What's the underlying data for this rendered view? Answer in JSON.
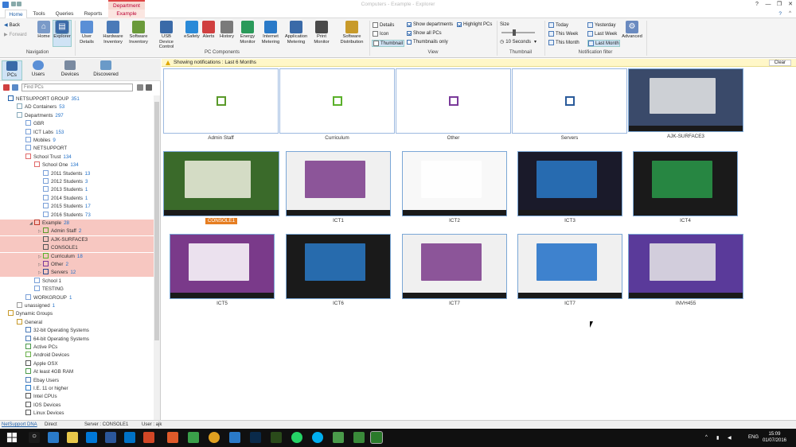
{
  "window": {
    "title": "Computers - Example - Explorer",
    "context_tab_group": "Department",
    "controls": [
      "?",
      "—",
      "❐",
      "✕"
    ]
  },
  "tabs": [
    {
      "label": "Home",
      "active": true
    },
    {
      "label": "Tools"
    },
    {
      "label": "Queries"
    },
    {
      "label": "Reports"
    },
    {
      "label": "Example",
      "contextual": true
    }
  ],
  "ribbon": {
    "navigation": {
      "back": "Back",
      "forward": "Forward",
      "home": "Home",
      "explorer": "Explorer",
      "group_label": "Navigation"
    },
    "pc_components": {
      "items": [
        {
          "label": "User Details",
          "icon": "user-details-icon",
          "color": "#5a8fd6"
        },
        {
          "label": "Hardware Inventory",
          "icon": "hardware-icon",
          "color": "#4a7ab8"
        },
        {
          "label": "Software Inventory",
          "icon": "software-icon",
          "color": "#6a9a3a"
        },
        {
          "label": "USB Device Control",
          "icon": "usb-icon",
          "color": "#3a6aa8"
        },
        {
          "label": "eSafety",
          "icon": "esafety-icon",
          "color": "#2a8ad8"
        },
        {
          "label": "Alerts",
          "icon": "alerts-icon",
          "color": "#d04040"
        },
        {
          "label": "History",
          "icon": "history-icon",
          "color": "#7a7a7a"
        },
        {
          "label": "Energy Monitor",
          "icon": "energy-icon",
          "color": "#2a9a5a"
        },
        {
          "label": "Internet Metering",
          "icon": "internet-icon",
          "color": "#2a7ac8"
        },
        {
          "label": "Application Metering",
          "icon": "application-icon",
          "color": "#3a6aa8"
        },
        {
          "label": "Print Monitor",
          "icon": "print-icon",
          "color": "#4a4a4a"
        },
        {
          "label": "Software Distribution",
          "icon": "distribution-icon",
          "color": "#c89a2a"
        }
      ],
      "group_label": "PC Components"
    },
    "view": {
      "modes": [
        "Details",
        "Icon",
        "Thumbnail"
      ],
      "selected_mode": "Thumbnail",
      "checks": [
        {
          "label": "Show departments",
          "checked": true
        },
        {
          "label": "Show all PCs",
          "checked": true
        },
        {
          "label": "Thumbnails only",
          "checked": false
        },
        {
          "label": "Highlight PCs",
          "checked": true
        }
      ],
      "group_label": "View"
    },
    "thumbnail": {
      "size_label": "Size",
      "interval": "10 Seconds",
      "group_label": "Thumbnail"
    },
    "notification_filter": {
      "items": [
        "Today",
        "This Week",
        "This Month",
        "Yesterday",
        "Last Week",
        "Last Month"
      ],
      "advanced": "Advanced",
      "group_label": "Notification filter"
    }
  },
  "left_nav": {
    "buttons": [
      "PCs",
      "Users",
      "Devices",
      "Discovered"
    ],
    "selected": "PCs",
    "search_placeholder": "Find PCs"
  },
  "tree": [
    {
      "label": "NETSUPPORT GROUP",
      "count": "351",
      "indent": 0,
      "color": "#1f5fa8"
    },
    {
      "label": "AD Containers",
      "count": "53",
      "indent": 1,
      "color": "#8ab"
    },
    {
      "label": "Departments",
      "count": "297",
      "indent": 1,
      "color": "#8ab"
    },
    {
      "label": "GBR",
      "count": "",
      "indent": 2,
      "color": "#7aa0d8"
    },
    {
      "label": "ICT Labs",
      "count": "153",
      "indent": 2,
      "color": "#7aa0d8"
    },
    {
      "label": "Mobiles",
      "count": "9",
      "indent": 2,
      "color": "#7aa0d8"
    },
    {
      "label": "NETSUPPORT",
      "count": "",
      "indent": 2,
      "color": "#7aa0d8"
    },
    {
      "label": "School Trust",
      "count": "134",
      "indent": 2,
      "color": "#e06a6a"
    },
    {
      "label": "School One",
      "count": "134",
      "indent": 3,
      "color": "#e06a6a"
    },
    {
      "label": "2011 Students",
      "count": "13",
      "indent": 4,
      "color": "#7aa0d8"
    },
    {
      "label": "2012 Students",
      "count": "3",
      "indent": 4,
      "color": "#7aa0d8"
    },
    {
      "label": "2013 Students",
      "count": "1",
      "indent": 4,
      "color": "#7aa0d8"
    },
    {
      "label": "2014 Students",
      "count": "1",
      "indent": 4,
      "color": "#7aa0d8"
    },
    {
      "label": "2015 Students",
      "count": "17",
      "indent": 4,
      "color": "#7aa0d8"
    },
    {
      "label": "2016 Students",
      "count": "73",
      "indent": 4,
      "color": "#7aa0d8"
    },
    {
      "label": "Example",
      "count": "28",
      "indent": 3,
      "color": "#c0392b",
      "highlight": true,
      "toggle": "◢"
    },
    {
      "label": "Admin Staff",
      "count": "2",
      "indent": 4,
      "color": "#5a9a2a",
      "highlight": true,
      "toggle": "▷"
    },
    {
      "label": "AJK-SURFACE3",
      "count": "",
      "indent": 4,
      "color": "#555",
      "highlight": true
    },
    {
      "label": "CONSOLE1",
      "count": "",
      "indent": 4,
      "color": "#555",
      "highlight": true
    },
    {
      "label": "Curriculum",
      "count": "18",
      "indent": 4,
      "color": "#5ab02a",
      "highlight": true,
      "toggle": "▷"
    },
    {
      "label": "Other",
      "count": "2",
      "indent": 4,
      "color": "#7a3a9a",
      "highlight": true,
      "toggle": "▷"
    },
    {
      "label": "Servers",
      "count": "12",
      "indent": 4,
      "color": "#2a4a8a",
      "highlight": true,
      "toggle": "▷"
    },
    {
      "label": "School 1",
      "count": "",
      "indent": 3,
      "color": "#7aa0d8"
    },
    {
      "label": "TESTING",
      "count": "",
      "indent": 3,
      "color": "#7aa0d8"
    },
    {
      "label": "WORKGROUP",
      "count": "1",
      "indent": 2,
      "color": "#7aa0d8"
    },
    {
      "label": "unassigned",
      "count": "1",
      "indent": 1,
      "color": "#999"
    },
    {
      "label": "Dynamic Groups",
      "count": "",
      "indent": 0,
      "color": "#c89a2a"
    },
    {
      "label": "General",
      "count": "",
      "indent": 1,
      "color": "#c89a2a"
    },
    {
      "label": "32-bit Operating Systems",
      "count": "",
      "indent": 2,
      "color": "#4a7ab8"
    },
    {
      "label": "64-bit Operating Systems",
      "count": "",
      "indent": 2,
      "color": "#4a7ab8"
    },
    {
      "label": "Active PCs",
      "count": "",
      "indent": 2,
      "color": "#4a9a4a"
    },
    {
      "label": "Android Devices",
      "count": "",
      "indent": 2,
      "color": "#6ab04a"
    },
    {
      "label": "Apple OSX",
      "count": "",
      "indent": 2,
      "color": "#555"
    },
    {
      "label": "At least 4GB RAM",
      "count": "",
      "indent": 2,
      "color": "#4a9a4a"
    },
    {
      "label": "Ebay Users",
      "count": "",
      "indent": 2,
      "color": "#4a7ab8"
    },
    {
      "label": "I.E. 11 or higher",
      "count": "",
      "indent": 2,
      "color": "#2a7ac8"
    },
    {
      "label": "Intel CPUs",
      "count": "",
      "indent": 2,
      "color": "#555"
    },
    {
      "label": "IOS Devices",
      "count": "",
      "indent": 2,
      "color": "#555"
    },
    {
      "label": "Linux Devices",
      "count": "",
      "indent": 2,
      "color": "#555"
    }
  ],
  "notification": {
    "text": "Showing notifications : Last 6 Months",
    "clear": "Clear"
  },
  "groups": [
    {
      "label": "Admin Staff",
      "color": "#5a9a2a"
    },
    {
      "label": "Curriculum",
      "color": "#5ab02a"
    },
    {
      "label": "Other",
      "color": "#7a3a9a"
    },
    {
      "label": "Servers",
      "color": "#2a5a9a"
    }
  ],
  "pcs": [
    {
      "label": "AJK-SURFACE3",
      "bg": "#3a4a6a",
      "accent": "#e8e8e8"
    },
    {
      "label": "CONSOLE1",
      "bg": "#3a6a2a",
      "accent": "#f0f0e0",
      "selected": true
    },
    {
      "label": "ICT1",
      "bg": "#f0f0f0",
      "accent": "#7a3a8a"
    },
    {
      "label": "ICT2",
      "bg": "#f8f8f8",
      "accent": "#ffffff"
    },
    {
      "label": "ICT3",
      "bg": "#1a1a2a",
      "accent": "#2a7ac8"
    },
    {
      "label": "ICT4",
      "bg": "#1a1a1a",
      "accent": "#2a9a4a"
    },
    {
      "label": "ICT5",
      "bg": "#7a3a8a",
      "accent": "#ffffff"
    },
    {
      "label": "ICT6",
      "bg": "#1a1a1a",
      "accent": "#2a7ac8"
    },
    {
      "label": "ICT7",
      "bg": "#f0f0f0",
      "accent": "#7a3a8a"
    },
    {
      "label": "ICT7",
      "bg": "#f0f0f0",
      "accent": "#1f6fc8"
    },
    {
      "label": "INVH455",
      "bg": "#5a3a9a",
      "accent": "#e8e8e8"
    }
  ],
  "statusbar": {
    "dna": "NetSupport DNA",
    "mode": "Direct",
    "server": "Server : CONSOLE1",
    "user": "User : ajk"
  },
  "taskbar": {
    "lang": "ENG",
    "time": "15:09",
    "date": "01/07/2016"
  }
}
